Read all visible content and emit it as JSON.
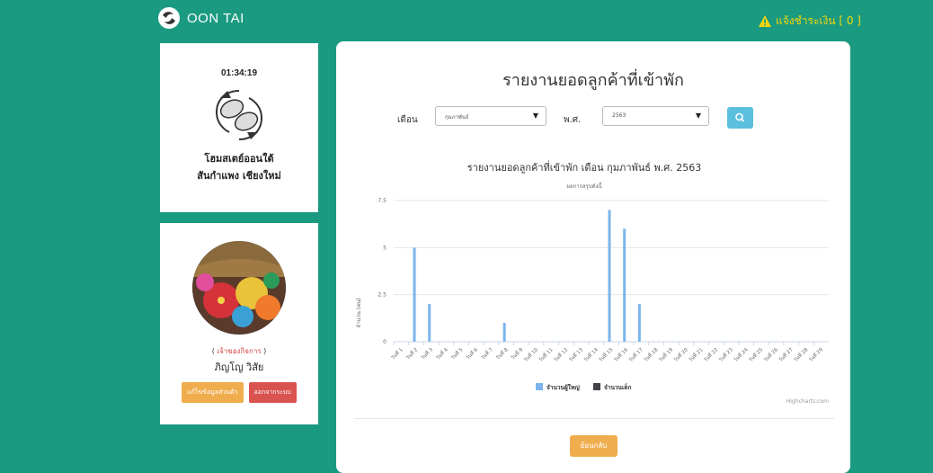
{
  "brand": {
    "name": "OON TAI"
  },
  "alert": {
    "label": "แจ้งชำระเงิน [ 0 ]"
  },
  "info": {
    "time": "01:34:19",
    "name_line1": "โฮมสเตย์ออนใต้",
    "name_line2": "สันกำแพง เชียงใหม่"
  },
  "profile": {
    "role": "เจ้าของกิจการ",
    "name": "ภิญโญ วิสัย",
    "edit_label": "แก้ไขข้อมูลส่วนตัว",
    "logout_label": "ออกจากระบบ"
  },
  "report": {
    "title": "รายงานยอดลูกค้าที่เข้าพัก",
    "month_label": "เดือน",
    "month_value": "กุมภาพันธ์",
    "year_label": "พ.ศ.",
    "year_value": "2563",
    "back_label": "ย้อนกลับ"
  },
  "chart_data": {
    "type": "bar",
    "title": "รายงานยอดลูกค้าที่เข้าพัก เดือน กุมภาพันธ์ พ.ศ. 2563",
    "subtitle": "ผลการสรุปดังนี้",
    "ylabel": "จำนวน (คน)",
    "xlabel": "",
    "ylim": [
      0,
      7.5
    ],
    "yticks": [
      0,
      2.5,
      5,
      7.5
    ],
    "categories": [
      "วันที่ 1",
      "วันที่ 2",
      "วันที่ 3",
      "วันที่ 4",
      "วันที่ 5",
      "วันที่ 6",
      "วันที่ 7",
      "วันที่ 8",
      "วันที่ 9",
      "วันที่ 10",
      "วันที่ 11",
      "วันที่ 12",
      "วันที่ 13",
      "วันที่ 14",
      "วันที่ 15",
      "วันที่ 16",
      "วันที่ 17",
      "วันที่ 18",
      "วันที่ 19",
      "วันที่ 20",
      "วันที่ 21",
      "วันที่ 22",
      "วันที่ 23",
      "วันที่ 24",
      "วันที่ 25",
      "วันที่ 26",
      "วันที่ 27",
      "วันที่ 28",
      "วันที่ 29"
    ],
    "series": [
      {
        "name": "จำนวนผู้ใหญ่",
        "color": "#7cb5ec",
        "values": [
          0,
          5,
          2,
          0,
          0,
          0,
          0,
          1,
          0,
          0,
          0,
          0,
          0,
          0,
          7,
          6,
          2,
          0,
          0,
          0,
          0,
          0,
          0,
          0,
          0,
          0,
          0,
          0,
          0
        ]
      },
      {
        "name": "จำนวนเด็ก",
        "color": "#434348",
        "values": [
          0,
          0,
          0,
          0,
          0,
          0,
          0,
          0,
          0,
          0,
          0,
          0,
          0,
          0,
          0,
          0,
          0,
          0,
          0,
          0,
          0,
          0,
          0,
          0,
          0,
          0,
          0,
          0,
          0
        ]
      }
    ],
    "legend": "bottom-center",
    "credits": "Highcharts.com",
    "grid": true
  }
}
